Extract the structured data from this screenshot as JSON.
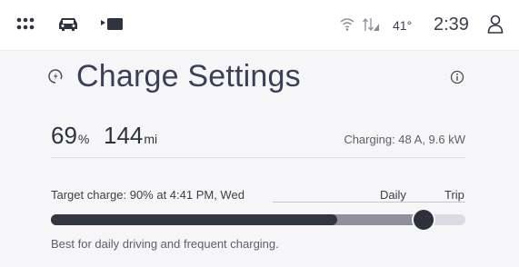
{
  "status_bar": {
    "icons_left": [
      "apps-grid-icon",
      "car-icon",
      "media-icon"
    ],
    "icons_right": [
      "wifi-icon",
      "signal-icon",
      "user-icon"
    ],
    "temperature": "41°",
    "time": "2:39"
  },
  "header": {
    "title": "Charge Settings",
    "title_icon": "charging-plug-icon",
    "info_icon": "info-icon"
  },
  "battery": {
    "percent": "69",
    "percent_unit": "%",
    "range": "144",
    "range_unit": "mi",
    "charging_status": "Charging: 48 A, 9.6 kW"
  },
  "target_charge": {
    "label": "Target charge: 90% at 4:41 PM, Wed",
    "presets": [
      "Daily",
      "Trip"
    ],
    "current_level_percent": 69,
    "target_level_percent": 90,
    "description": "Best for daily driving and frequent charging."
  },
  "colors": {
    "background": "#ffffff",
    "panel": "#f6f6f8",
    "text": "#2f3340",
    "slider_fill": "#33363f",
    "slider_target": "#8f9098",
    "slider_track": "#dadbe0"
  }
}
